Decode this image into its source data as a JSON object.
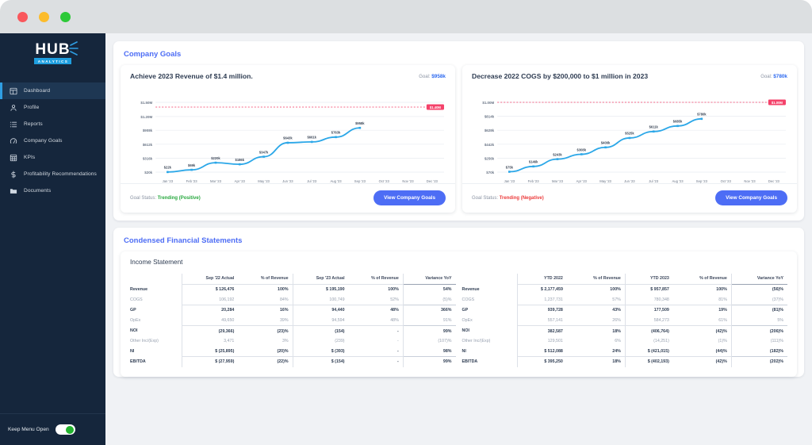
{
  "window": {
    "dots": [
      "close",
      "minimize",
      "maximize"
    ]
  },
  "sidebar": {
    "logo": {
      "name": "HUB",
      "sub": "ANALYTICS"
    },
    "items": [
      {
        "label": "Dashboard",
        "icon": "dashboard-icon",
        "active": true
      },
      {
        "label": "Profile",
        "icon": "profile-icon",
        "active": false
      },
      {
        "label": "Reports",
        "icon": "reports-icon",
        "active": false
      },
      {
        "label": "Company Goals",
        "icon": "goals-icon",
        "active": false
      },
      {
        "label": "KPIs",
        "icon": "kpis-icon",
        "active": false
      },
      {
        "label": "Profitability Recommendations",
        "icon": "dollar-icon",
        "active": false
      },
      {
        "label": "Documents",
        "icon": "folder-icon",
        "active": false
      }
    ],
    "keep_menu_open": {
      "label": "Keep Menu Open",
      "state": "on"
    }
  },
  "company_goals": {
    "section_title": "Company Goals",
    "cards": [
      {
        "title": "Achieve 2023 Revenue of $1.4 million.",
        "goal_label": "Goal:",
        "goal_value": "$958k",
        "target_badge": "$1.40M",
        "status_label": "Goal Status:",
        "status_value": "Trending (Positive)",
        "status_type": "positive",
        "button": "View Company Goals"
      },
      {
        "title": "Decrease 2022 COGS by $200,000 to $1 million in 2023",
        "goal_label": "Goal:",
        "goal_value": "$780k",
        "target_badge": "$1.00M",
        "status_label": "Goal Status:",
        "status_value": "Trending (Negative)",
        "status_type": "negative",
        "button": "View Company Goals"
      }
    ]
  },
  "chart_data": [
    {
      "type": "line",
      "title": "Achieve 2023 Revenue of $1.4 million.",
      "xlabel": "",
      "ylabel": "",
      "categories": [
        "Jan '23",
        "Feb '23",
        "Mar '23",
        "Apr '23",
        "May '23",
        "Jun '23",
        "Jul '23",
        "Aug '23",
        "Sep '23",
        "Oct '23",
        "Nov '23",
        "Dec '23"
      ],
      "ytick_labels": [
        "$1.50M",
        "$1.20M",
        "$908k",
        "$612k",
        "$316k",
        "$20k"
      ],
      "ytick_values": [
        1500000,
        1200000,
        908000,
        612000,
        316000,
        20000
      ],
      "ylim": [
        20000,
        1500000
      ],
      "values": [
        22000,
        69000,
        220000,
        186000,
        347000,
        643000,
        661000,
        763000,
        958000,
        null,
        null,
        null
      ],
      "point_labels": [
        "$22k",
        "$69k",
        "$220k",
        "$186k",
        "$347k",
        "$643k",
        "$661k",
        "$763k",
        "$958k",
        "",
        "",
        ""
      ],
      "target_line": {
        "value": 1400000,
        "label": "$1.40M",
        "color": "#f4426a",
        "style": "dashed"
      },
      "line_color": "#2ba7e8",
      "grid": true,
      "legend": "none"
    },
    {
      "type": "line",
      "title": "Decrease 2022 COGS by $200,000 to $1 million in 2023",
      "xlabel": "",
      "ylabel": "",
      "categories": [
        "Jan '23",
        "Feb '23",
        "Mar '23",
        "Apr '23",
        "May '23",
        "Jun '23",
        "Jul '23",
        "Aug '23",
        "Sep '23",
        "Oct '23",
        "Nov '23",
        "Dec '23"
      ],
      "ytick_labels": [
        "$1.00M",
        "$814k",
        "$628k",
        "$442k",
        "$256k",
        "$70k"
      ],
      "ytick_values": [
        1000000,
        814000,
        628000,
        442000,
        256000,
        70000
      ],
      "ylim": [
        70000,
        1000000
      ],
      "values": [
        75000,
        146000,
        243000,
        308000,
        400000,
        525000,
        611000,
        685000,
        780000,
        null,
        null,
        null
      ],
      "point_labels": [
        "$75k",
        "$146k",
        "$243k",
        "$308k",
        "$400k",
        "$525k",
        "$611k",
        "$685k",
        "$780k",
        "",
        "",
        ""
      ],
      "target_line": {
        "value": 1000000,
        "label": "$1.00M",
        "color": "#f4426a",
        "style": "dashed"
      },
      "line_color": "#2ba7e8",
      "grid": true,
      "legend": "none"
    }
  ],
  "financials": {
    "section_title": "Condensed Financial Statements",
    "subtitle": "Income Statement",
    "left_table": {
      "headers": [
        "",
        "Sep '22 Actual",
        "% of Revenue",
        "Sep '23 Actual",
        "% of Revenue",
        "Variance YoY"
      ],
      "rows": [
        {
          "label": "Revenue",
          "bold": true,
          "c1": "126,476",
          "cur1": "$",
          "p1": "100%",
          "c2": "195,190",
          "cur2": "$",
          "p2": "100%",
          "var": "54%"
        },
        {
          "label": "COGS",
          "bold": false,
          "c1": "106,192",
          "cur1": "",
          "p1": "84%",
          "c2": "100,749",
          "cur2": "",
          "p2": "52%",
          "var": "(5)%"
        },
        {
          "label": "GP",
          "bold": true,
          "c1": "20,284",
          "cur1": "",
          "p1": "16%",
          "c2": "94,440",
          "cur2": "",
          "p2": "48%",
          "var": "366%"
        },
        {
          "label": "OpEx",
          "bold": false,
          "c1": "49,650",
          "cur1": "",
          "p1": "39%",
          "c2": "94,594",
          "cur2": "",
          "p2": "48%",
          "var": "91%"
        },
        {
          "label": "NOI",
          "bold": true,
          "c1": "(29,366)",
          "cur1": "",
          "p1": "(23)%",
          "c2": "(154)",
          "cur2": "",
          "p2": "-",
          "var": "99%"
        },
        {
          "label": "Other Inc/(Exp)",
          "bold": false,
          "c1": "3,471",
          "cur1": "",
          "p1": "3%",
          "c2": "(239)",
          "cur2": "",
          "p2": "-",
          "var": "(107)%"
        },
        {
          "label": "NI",
          "bold": true,
          "c1": "(25,895)",
          "cur1": "$",
          "p1": "(20)%",
          "c2": "(393)",
          "cur2": "$",
          "p2": "-",
          "var": "98%"
        },
        {
          "label": "EBITDA",
          "bold": true,
          "c1": "(27,959)",
          "cur1": "$",
          "p1": "(22)%",
          "c2": "(154)",
          "cur2": "$",
          "p2": "-",
          "var": "99%"
        }
      ]
    },
    "right_table": {
      "headers": [
        "",
        "YTD 2022",
        "% of Revenue",
        "YTD 2023",
        "% of Revenue",
        "Variance YoY"
      ],
      "rows": [
        {
          "label": "Revenue",
          "bold": true,
          "c1": "2,177,459",
          "cur1": "$",
          "p1": "100%",
          "c2": "957,857",
          "cur2": "$",
          "p2": "100%",
          "var": "(56)%"
        },
        {
          "label": "COGS",
          "bold": false,
          "c1": "1,237,731",
          "cur1": "",
          "p1": "57%",
          "c2": "780,348",
          "cur2": "",
          "p2": "81%",
          "var": "(37)%"
        },
        {
          "label": "GP",
          "bold": true,
          "c1": "939,728",
          "cur1": "",
          "p1": "43%",
          "c2": "177,509",
          "cur2": "",
          "p2": "19%",
          "var": "(81)%"
        },
        {
          "label": "OpEx",
          "bold": false,
          "c1": "557,141",
          "cur1": "",
          "p1": "26%",
          "c2": "584,273",
          "cur2": "",
          "p2": "61%",
          "var": "5%"
        },
        {
          "label": "NOI",
          "bold": true,
          "c1": "382,587",
          "cur1": "",
          "p1": "18%",
          "c2": "(406,764)",
          "cur2": "",
          "p2": "(42)%",
          "var": "(206)%"
        },
        {
          "label": "Other Inc/(Exp)",
          "bold": false,
          "c1": "129,501",
          "cur1": "",
          "p1": "6%",
          "c2": "(14,251)",
          "cur2": "",
          "p2": "(1)%",
          "var": "(111)%"
        },
        {
          "label": "NI",
          "bold": true,
          "c1": "512,088",
          "cur1": "$",
          "p1": "24%",
          "c2": "(421,015)",
          "cur2": "$",
          "p2": "(44)%",
          "var": "(182)%"
        },
        {
          "label": "EBITDA",
          "bold": true,
          "c1": "395,250",
          "cur1": "$",
          "p1": "18%",
          "c2": "(402,193)",
          "cur2": "$",
          "p2": "(42)%",
          "var": "(202)%"
        }
      ]
    }
  },
  "colors": {
    "accent_blue": "#4d6df5",
    "line_blue": "#2ba7e8",
    "target_red": "#f4426a",
    "positive_green": "#27a83e",
    "negative_red": "#ec3b3b",
    "sidebar_bg": "#15263c"
  }
}
